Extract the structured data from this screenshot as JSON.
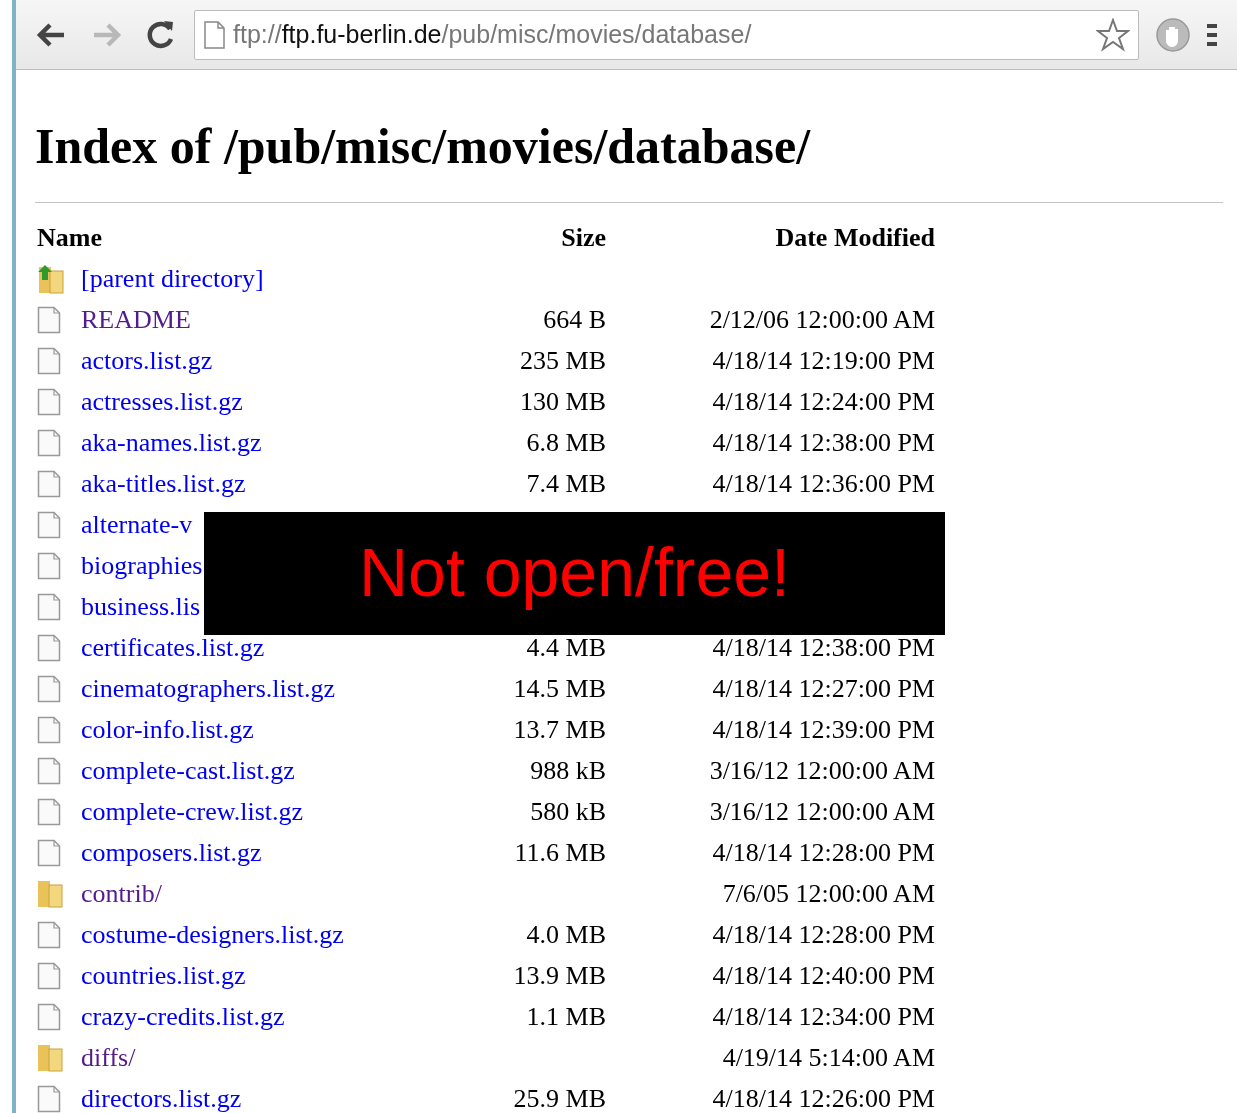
{
  "browser": {
    "back_enabled": true,
    "forward_enabled": false,
    "url": {
      "scheme": "ftp://",
      "host": "ftp.fu-berlin.de",
      "path": "/pub/misc/movies/database/"
    }
  },
  "page": {
    "title": "Index of /pub/misc/movies/database/",
    "columns": [
      "Name",
      "Size",
      "Date Modified"
    ],
    "rows": [
      {
        "kind": "parent",
        "name": "[parent directory]",
        "visited": false
      },
      {
        "kind": "file",
        "name": "README",
        "size": "664 B",
        "date": "2/12/06 12:00:00 AM",
        "visited": true
      },
      {
        "kind": "file",
        "name": "actors.list.gz",
        "size": "235 MB",
        "date": "4/18/14 12:19:00 PM",
        "visited": false
      },
      {
        "kind": "file",
        "name": "actresses.list.gz",
        "size": "130 MB",
        "date": "4/18/14 12:24:00 PM",
        "visited": false
      },
      {
        "kind": "file",
        "name": "aka-names.list.gz",
        "size": "6.8 MB",
        "date": "4/18/14 12:38:00 PM",
        "visited": false
      },
      {
        "kind": "file",
        "name": "aka-titles.list.gz",
        "size": "7.4 MB",
        "date": "4/18/14 12:36:00 PM",
        "visited": false
      },
      {
        "kind": "file",
        "name": "alternate-v",
        "visited": false
      },
      {
        "kind": "file",
        "name": "biographies",
        "visited": false
      },
      {
        "kind": "file",
        "name": "business.lis",
        "visited": false
      },
      {
        "kind": "file",
        "name": "certificates.list.gz",
        "size": "4.4 MB",
        "date": "4/18/14 12:38:00 PM",
        "visited": false
      },
      {
        "kind": "file",
        "name": "cinematographers.list.gz",
        "size": "14.5 MB",
        "date": "4/18/14 12:27:00 PM",
        "visited": false
      },
      {
        "kind": "file",
        "name": "color-info.list.gz",
        "size": "13.7 MB",
        "date": "4/18/14 12:39:00 PM",
        "visited": false
      },
      {
        "kind": "file",
        "name": "complete-cast.list.gz",
        "size": "988 kB",
        "date": "3/16/12 12:00:00 AM",
        "visited": false
      },
      {
        "kind": "file",
        "name": "complete-crew.list.gz",
        "size": "580 kB",
        "date": "3/16/12 12:00:00 AM",
        "visited": false
      },
      {
        "kind": "file",
        "name": "composers.list.gz",
        "size": "11.6 MB",
        "date": "4/18/14 12:28:00 PM",
        "visited": false
      },
      {
        "kind": "folder",
        "name": "contrib/",
        "date": "7/6/05 12:00:00 AM",
        "visited": true
      },
      {
        "kind": "file",
        "name": "costume-designers.list.gz",
        "size": "4.0 MB",
        "date": "4/18/14 12:28:00 PM",
        "visited": false
      },
      {
        "kind": "file",
        "name": "countries.list.gz",
        "size": "13.9 MB",
        "date": "4/18/14 12:40:00 PM",
        "visited": false
      },
      {
        "kind": "file",
        "name": "crazy-credits.list.gz",
        "size": "1.1 MB",
        "date": "4/18/14 12:34:00 PM",
        "visited": false
      },
      {
        "kind": "folder",
        "name": "diffs/",
        "date": "4/19/14 5:14:00 AM",
        "visited": true
      },
      {
        "kind": "file",
        "name": "directors.list.gz",
        "size": "25.9 MB",
        "date": "4/18/14 12:26:00 PM",
        "visited": false
      }
    ]
  },
  "overlay": {
    "text": "Not open/free!"
  }
}
